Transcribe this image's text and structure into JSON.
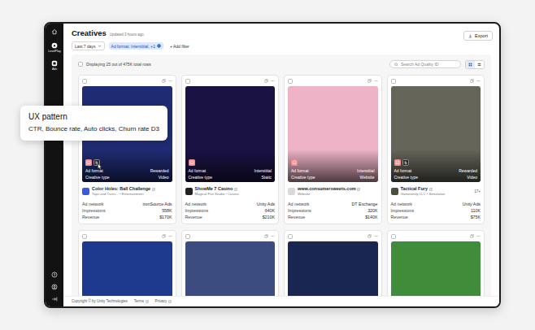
{
  "sidebar": {
    "items": [
      {
        "label": "LevelPlay",
        "kind": "levelplay"
      },
      {
        "label": "Ads",
        "kind": "ads"
      }
    ]
  },
  "header": {
    "title": "Creatives",
    "updated": "Updated 3 hours ago",
    "export": "Export"
  },
  "filters": [
    {
      "label": "Last 7 days",
      "kind": "dropdown"
    },
    {
      "label": "Ad format: Interstitial, +1",
      "kind": "chip"
    },
    {
      "label": "+ Add filter",
      "kind": "add"
    }
  ],
  "toolbar": {
    "select_all_checked": false,
    "count": "Displaying 25 out of 475K total rows",
    "search_placeholder": "Search Ad Quality ID",
    "views": [
      {
        "kind": "grid",
        "selected": true
      },
      {
        "kind": "list",
        "selected": false
      }
    ]
  },
  "cards": [
    {
      "kind": "full",
      "checked": false,
      "color": "#1f2c74",
      "markers": [
        {
          "kind": "ux",
          "hovered": false
        },
        {
          "kind": "tag",
          "hovered": true
        }
      ],
      "overlay": [
        {
          "label": "Ad format",
          "value": "Rewarded"
        },
        {
          "label": "Creative type",
          "value": "Video"
        }
      ],
      "app": {
        "name": "Color Holes: Ball Challenge",
        "sub": "Tops and Turns... • Entertainment",
        "icon_color": "#3b5bd6"
      },
      "metrics": [
        {
          "label": "Ad network",
          "value": "ironSource Ads"
        },
        {
          "label": "Impressions",
          "value": "558K"
        },
        {
          "label": "Revenue",
          "value": "$170K"
        }
      ]
    },
    {
      "kind": "full",
      "checked": false,
      "color": "#1b1244",
      "markers": [
        {
          "kind": "ux",
          "hovered": false
        }
      ],
      "overlay": [
        {
          "label": "Ad format",
          "value": "Interstitial"
        },
        {
          "label": "Creative type",
          "value": "Static"
        }
      ],
      "app": {
        "name": "ShowMe 7 Casino",
        "sub": "Magical Fun Studio • Casino",
        "icon_color": "#222222"
      },
      "metrics": [
        {
          "label": "Ad network",
          "value": "Unity Ads"
        },
        {
          "label": "Impressions",
          "value": "640K"
        },
        {
          "label": "Revenue",
          "value": "$210K"
        }
      ]
    },
    {
      "kind": "full",
      "checked": false,
      "color": "#eeb3c6",
      "markers": [
        {
          "kind": "ux",
          "hovered": false
        }
      ],
      "overlay": [
        {
          "label": "Ad format",
          "value": "Interstitial"
        },
        {
          "label": "Creative type",
          "value": "Website"
        }
      ],
      "app": {
        "name": "www.consumersweets.com",
        "sub": "Website",
        "icon_color": "#d9d9d9"
      },
      "metrics": [
        {
          "label": "Ad network",
          "value": "DT Exchange"
        },
        {
          "label": "Impressions",
          "value": "320K"
        },
        {
          "label": "Revenue",
          "value": "$140K"
        }
      ]
    },
    {
      "kind": "full",
      "checked": false,
      "color": "#66655a",
      "markers": [
        {
          "kind": "ux",
          "hovered": false
        },
        {
          "kind": "tag",
          "hovered": false
        }
      ],
      "overlay": [
        {
          "label": "Ad format",
          "value": "Rewarded"
        },
        {
          "label": "Creative type",
          "value": "Video"
        }
      ],
      "app": {
        "name": "Tactical Fury",
        "sub": "Gametenity LLC • Simulation",
        "icon_color": "#4a4f3a",
        "badge": "17+"
      },
      "metrics": [
        {
          "label": "Ad network",
          "value": "Unity Ads"
        },
        {
          "label": "Impressions",
          "value": "110K"
        },
        {
          "label": "Revenue",
          "value": "$75K"
        }
      ]
    },
    {
      "kind": "partial",
      "checked": false,
      "color": "#1e3a8f",
      "markers": [],
      "overlay": []
    },
    {
      "kind": "partial",
      "checked": false,
      "color": "#3d4c80",
      "markers": [],
      "overlay": []
    },
    {
      "kind": "partial",
      "checked": false,
      "color": "#1a2652",
      "markers": [],
      "overlay": []
    },
    {
      "kind": "partial",
      "checked": false,
      "color": "#3f8d3a",
      "markers": [],
      "overlay": []
    }
  ],
  "footer": {
    "copyright": "Copyright © by Unity Technologies",
    "links": [
      "Terms",
      "Privacy"
    ]
  },
  "tooltip": {
    "title": "UX pattern",
    "body": "CTR, Bounce rate, Auto clicks, Churn rate D3"
  }
}
